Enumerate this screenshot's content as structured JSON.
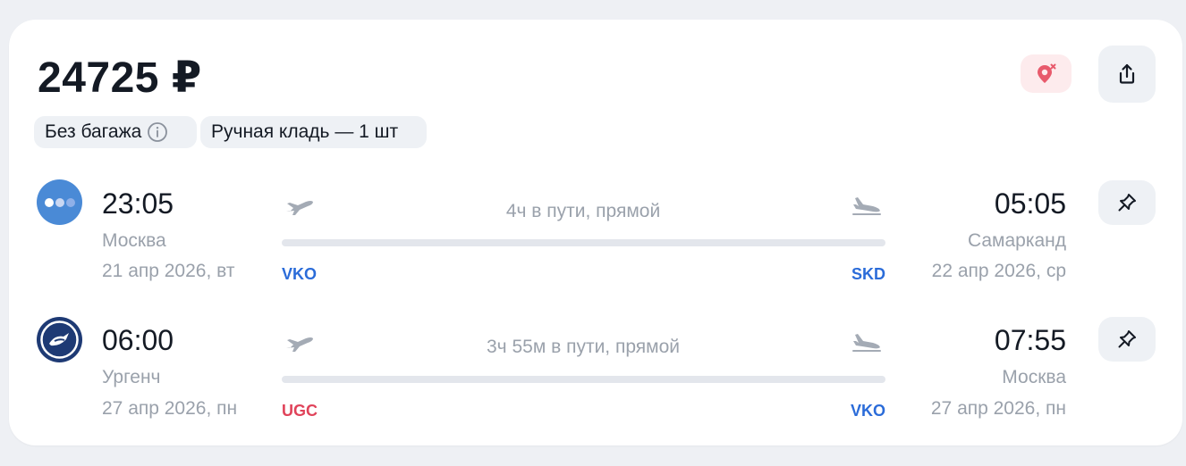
{
  "offer": {
    "price": "24725 ₽",
    "baggage_label": "Без багажа",
    "hand_luggage_label": "Ручная кладь — 1 шт"
  },
  "colors": {
    "code_blue": "#2b6cd9",
    "code_red": "#e0435a",
    "location_pink": "#e85a6c"
  },
  "flights": [
    {
      "dep_time": "23:05",
      "dep_city": "Москва",
      "dep_date": "21 апр 2026, вт",
      "dep_code": "VKO",
      "duration": "4ч в пути, прямой",
      "arr_time": "05:05",
      "arr_city": "Самарканд",
      "arr_date": "22 апр 2026, ср",
      "arr_code": "SKD"
    },
    {
      "dep_time": "06:00",
      "dep_city": "Ургенч",
      "dep_date": "27 апр 2026, пн",
      "dep_code": "UGC",
      "duration": "3ч 55м в пути, прямой",
      "arr_time": "07:55",
      "arr_city": "Москва",
      "arr_date": "27 апр 2026, пн",
      "arr_code": "VKO"
    }
  ]
}
